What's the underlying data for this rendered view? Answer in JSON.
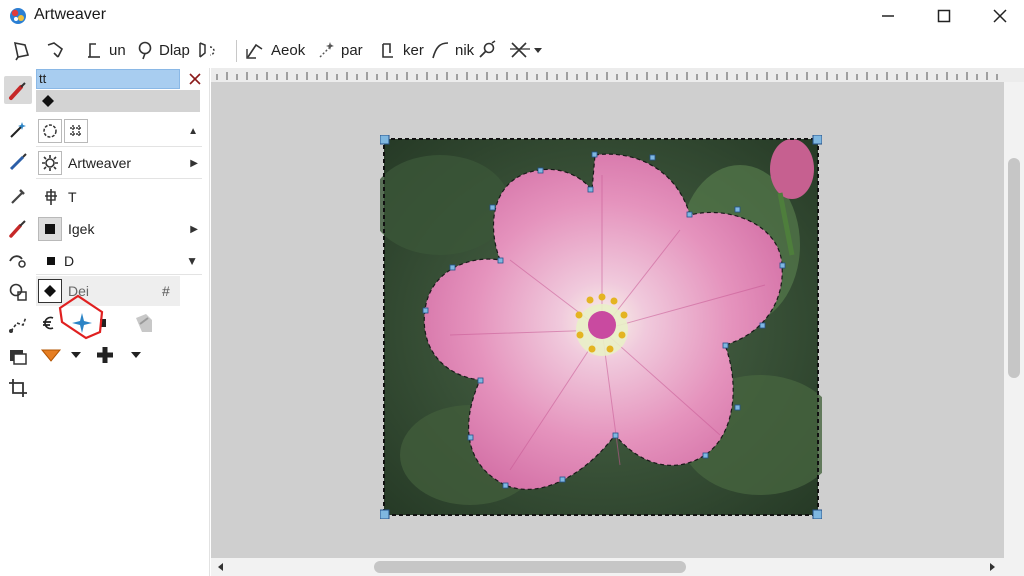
{
  "app": {
    "title": "Artweaver"
  },
  "toolbar": {
    "items": [
      {
        "label": "un",
        "icon": "person-icon"
      },
      {
        "label": "Dlap",
        "icon": "lasso-icon"
      },
      {
        "label": "Aeok",
        "icon": "brush-select-icon"
      },
      {
        "label": "par",
        "icon": "sparkle-icon"
      },
      {
        "label": "ker",
        "icon": "bucket-icon"
      },
      {
        "label": "nik",
        "icon": "curve-icon"
      }
    ]
  },
  "panel": {
    "field1": "tt",
    "row_artweaver": "Artweaver",
    "row_t": "T",
    "row_igek": "Igek",
    "row_d": "D",
    "row_dei": "Dei"
  },
  "colors": {
    "accent": "#6aaee8",
    "selection": "#2b84c6",
    "highlight_red": "#e02020",
    "canvas_bg": "#cfcfcf"
  }
}
